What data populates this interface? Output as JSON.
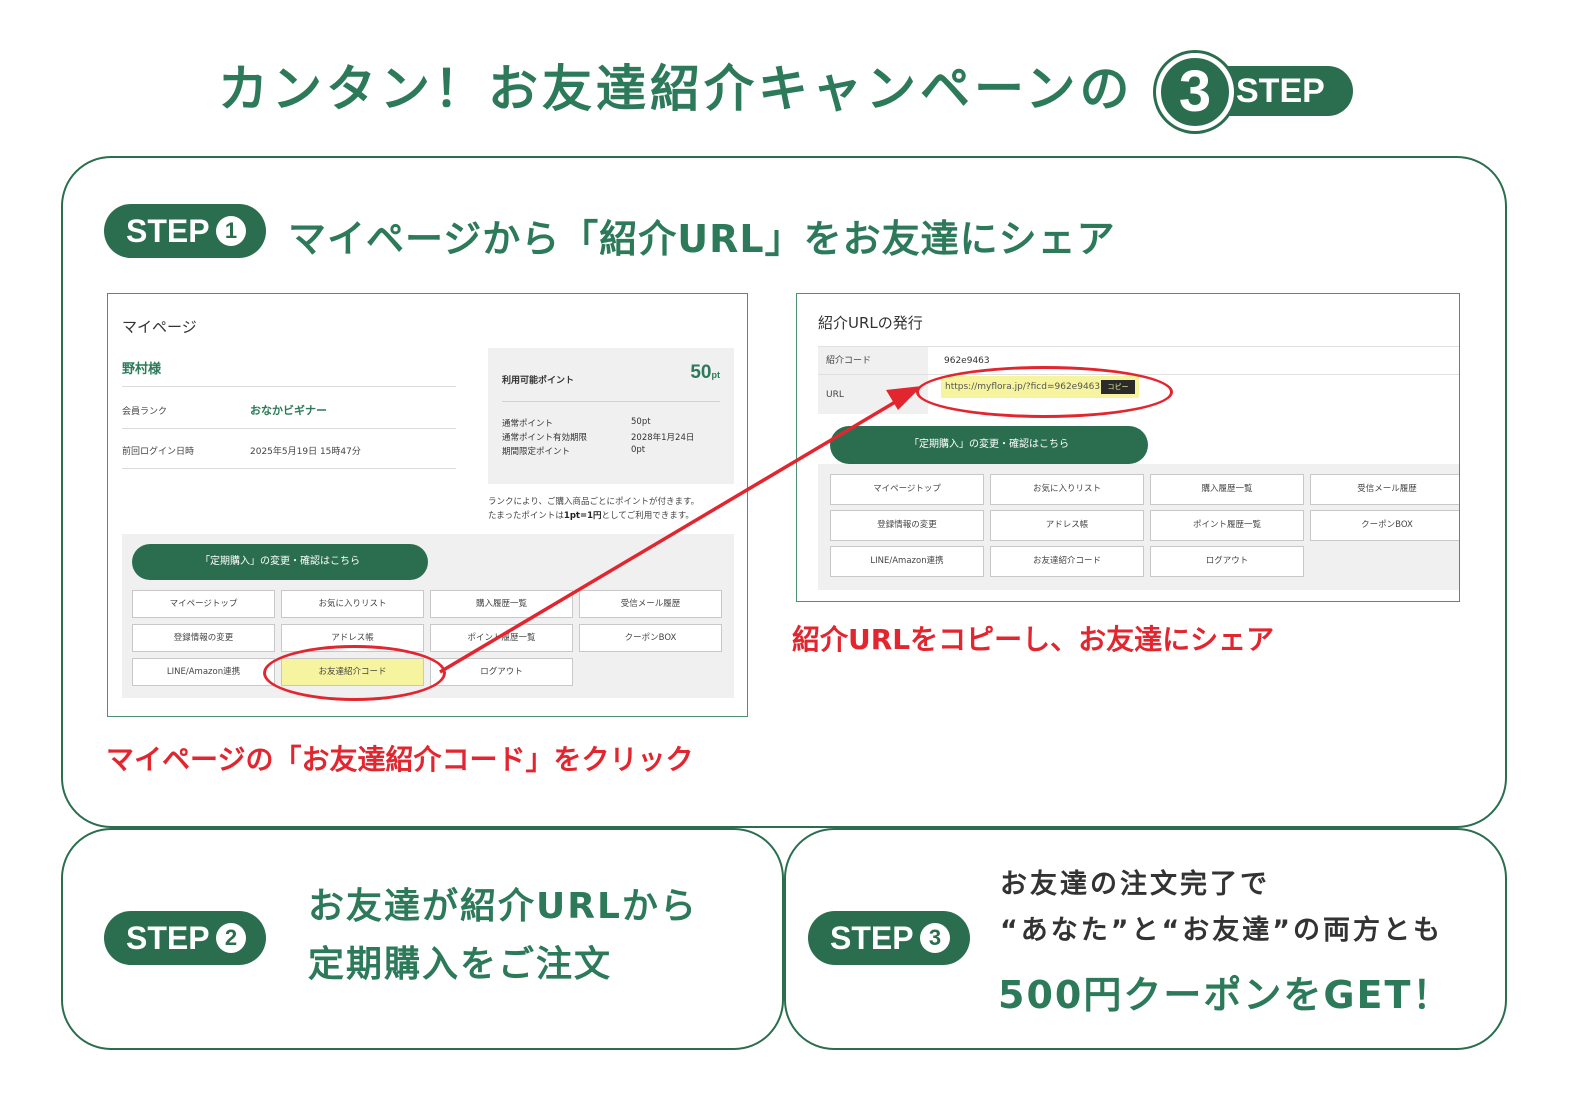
{
  "title": {
    "main": "カンタン！お友達紹介キャンペーンの",
    "step_number": "3",
    "step_word": "STEP"
  },
  "step1": {
    "label": "STEP",
    "number": "1",
    "heading": "マイページから「紹介URL」をお友達にシェア",
    "caption_left": "マイページの「お友達紹介コード」をクリック",
    "caption_right": "紹介URLをコピーし、お友達にシェア"
  },
  "mypage": {
    "title": "マイページ",
    "user_name": "野村様",
    "rank_label": "会員ランク",
    "rank_value": "おなかビギナー",
    "login_label": "前回ログイン日時",
    "login_value": "2025年5月19日 15時47分",
    "points_label": "利用可能ポイント",
    "points_value": "50",
    "points_unit": "pt",
    "point_rows": [
      {
        "label": "通常ポイント",
        "value": "50pt"
      },
      {
        "label": "通常ポイント有効期限",
        "value": "2028年1月24日"
      },
      {
        "label": "期間限定ポイント",
        "value": "0pt"
      }
    ],
    "note_line1": "ランクにより、ご購入商品ごとにポイントが付きます。",
    "note_line2_pre": "たまったポイントは",
    "note_line2_bold": "1pt=1円",
    "note_line2_post": "としてご利用できます。",
    "teiki_button": "「定期購入」の変更・確認はこちら",
    "menu": [
      "マイページトップ",
      "お気に入りリスト",
      "購入履歴一覧",
      "受信メール履歴",
      "登録情報の変更",
      "アドレス帳",
      "ポイント履歴一覧",
      "クーポンBOX",
      "LINE/Amazon連携",
      "お友達紹介コード",
      "ログアウト"
    ]
  },
  "referral": {
    "title": "紹介URLの発行",
    "code_label": "紹介コード",
    "code_value": "962e9463",
    "url_label": "URL",
    "url_value": "https://myflora.jp/?ficd=962e9463",
    "copy_button": "コピー",
    "teiki_button": "「定期購入」の変更・確認はこちら",
    "menu": [
      "マイページトップ",
      "お気に入りリスト",
      "購入履歴一覧",
      "受信メール履歴",
      "登録情報の変更",
      "アドレス帳",
      "ポイント履歴一覧",
      "クーポンBOX",
      "LINE/Amazon連携",
      "お友達紹介コード",
      "ログアウト"
    ]
  },
  "step2": {
    "label": "STEP",
    "number": "2",
    "line1": "お友達が紹介URLから",
    "line2": "定期購入をご注文"
  },
  "step3": {
    "label": "STEP",
    "number": "3",
    "line1": "お友達の注文完了で",
    "line2": "“あなた”と“お友達”の両方とも",
    "line3": "500円クーポンをGET！"
  },
  "colors": {
    "brand_green": "#2b6e4f",
    "text_green": "#2d7a5a",
    "highlight_red": "#e2262f",
    "highlight_yellow": "#f7f4a0"
  },
  "icons": {
    "arrow": "red-arrow-icon"
  }
}
